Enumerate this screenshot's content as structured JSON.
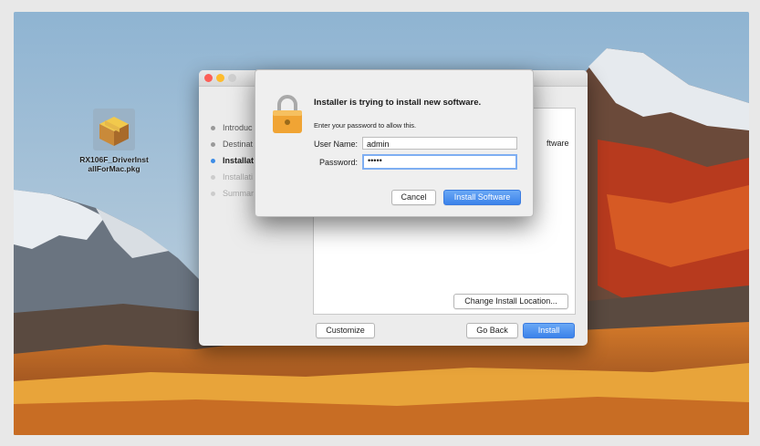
{
  "desktop": {
    "package_file": {
      "name_line1": "RX106F_DriverInst",
      "name_line2": "allForMac.pkg",
      "icon": "package-box-icon"
    }
  },
  "installer": {
    "steps": [
      {
        "label": "Introduc",
        "state": "done"
      },
      {
        "label": "Destinat",
        "state": "done"
      },
      {
        "label": "Installat",
        "state": "active"
      },
      {
        "label": "Installati",
        "state": "pending"
      },
      {
        "label": "Summar",
        "state": "pending"
      }
    ],
    "content_text_fragment": "ftware",
    "buttons": {
      "change_location": "Change Install Location...",
      "customize": "Customize",
      "go_back": "Go Back",
      "install": "Install"
    }
  },
  "auth_dialog": {
    "icon": "lock-icon",
    "title": "Installer is trying to install new software.",
    "subtitle": "Enter your password to allow this.",
    "username_label": "User Name:",
    "username_value": "admin",
    "password_label": "Password:",
    "password_value": "•••••",
    "cancel_label": "Cancel",
    "confirm_label": "Install Software"
  },
  "colors": {
    "accent_blue": "#3b82ea",
    "close": "#fc5f57",
    "minimize": "#fdbc2e"
  }
}
